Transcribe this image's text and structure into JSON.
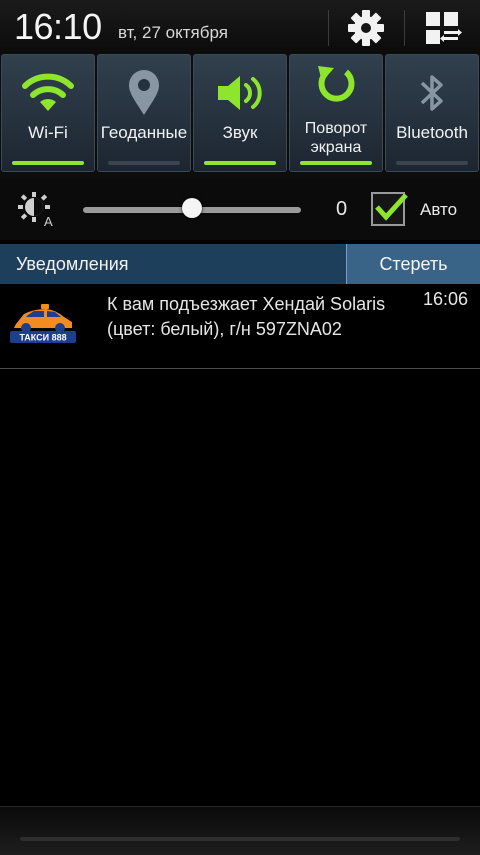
{
  "status": {
    "time": "16:10",
    "date": "вт, 27 октября"
  },
  "header_buttons": {
    "settings_icon": "gear-icon",
    "multiwindow_icon": "grid-edit-icon"
  },
  "quick_toggles": [
    {
      "label": "Wi-Fi",
      "icon": "wifi-icon",
      "on": true
    },
    {
      "label": "Геоданные",
      "icon": "location-pin-icon",
      "on": false
    },
    {
      "label": "Звук",
      "icon": "speaker-icon",
      "on": true
    },
    {
      "label": "Поворот экрана",
      "icon": "rotate-icon",
      "on": true
    },
    {
      "label": "Bluetooth",
      "icon": "bluetooth-icon",
      "on": false
    }
  ],
  "brightness": {
    "value": "0",
    "level": 0.5,
    "auto_label": "Авто",
    "auto_checked": true
  },
  "notifications": {
    "title": "Уведомления",
    "clear_label": "Стереть",
    "items": [
      {
        "app_name": "ТАКСИ 888",
        "text": "К вам подъезжает Хендай Solaris (цвет: белый), г/н 597ZNA02",
        "time": "16:06"
      }
    ]
  },
  "colors": {
    "accent_green": "#8ee62c",
    "notif_header": "#1e3f5c",
    "clear_button": "#3a6487",
    "taxi_orange": "#f28c1e",
    "taxi_blue": "#1d3f8e"
  }
}
